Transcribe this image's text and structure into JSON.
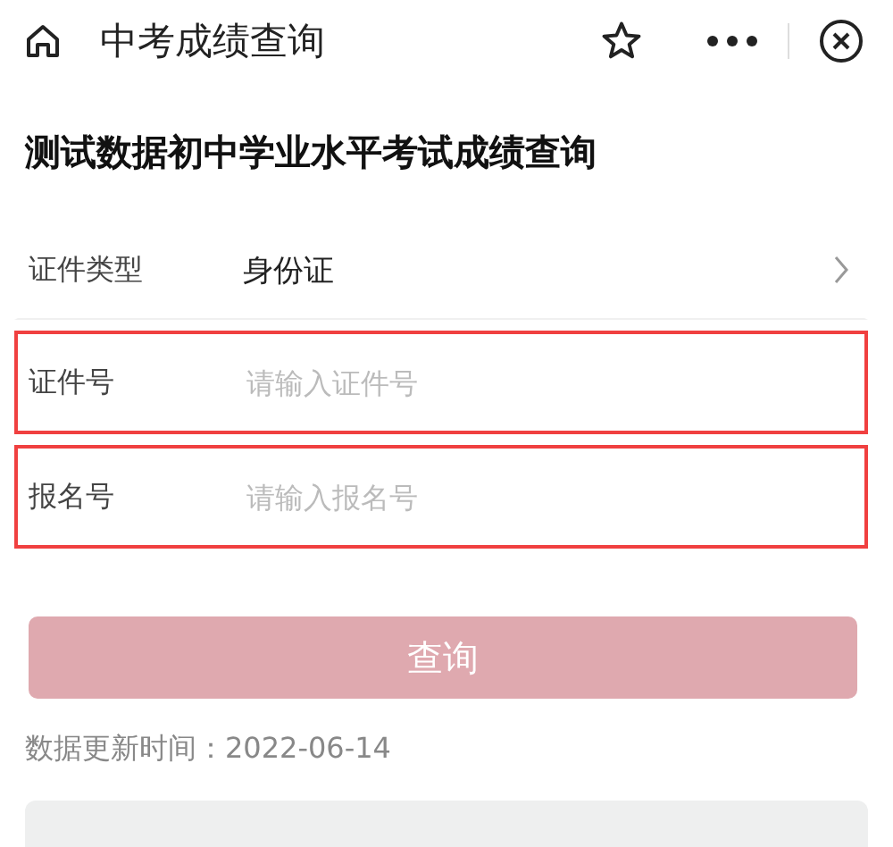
{
  "header": {
    "title": "中考成绩查询"
  },
  "page_title": "测试数据初中学业水平考试成绩查询",
  "form_rows": [
    {
      "kind": "select",
      "label": "证件类型",
      "value": "身份证",
      "highlighted": false
    },
    {
      "kind": "input",
      "label": "证件号",
      "placeholder": "请输入证件号",
      "highlighted": true
    },
    {
      "kind": "input",
      "label": "报名号",
      "placeholder": "请输入报名号",
      "highlighted": true
    }
  ],
  "query_button": {
    "label": "查询",
    "disabled": true
  },
  "update_note": {
    "label": "数据更新时间：",
    "date": "2022-06-14"
  }
}
